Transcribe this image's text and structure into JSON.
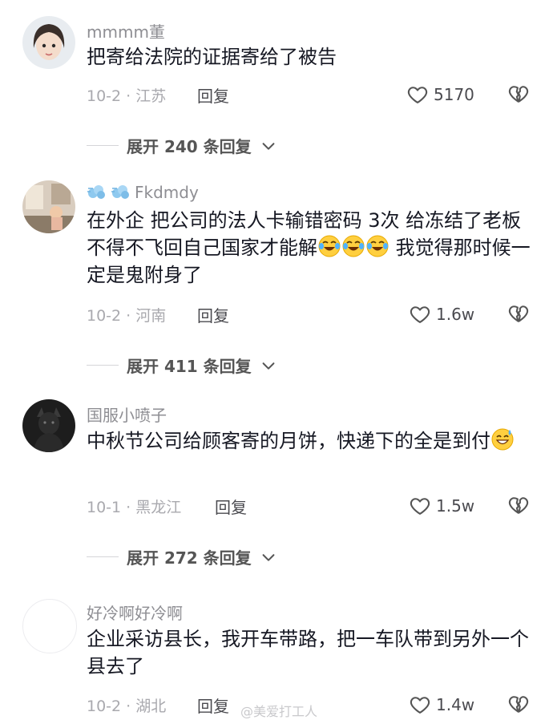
{
  "comments": [
    {
      "username": "mmmm董",
      "text": "把寄给法院的证据寄给了被告",
      "date": "10-2 · 江苏",
      "reply": "回复",
      "likes": "5170",
      "expand": "展开 240 条回复"
    },
    {
      "username": "Fkdmdy",
      "text_a": "在外企 把公司的法人卡输错密码 3次 给冻结了老板不得不飞回自己国家才能解",
      "text_b": " 我觉得那时候一定是鬼附身了",
      "date": "10-2 · 河南",
      "reply": "回复",
      "likes": "1.6w",
      "expand": "展开 411 条回复"
    },
    {
      "username": "国服小喷子",
      "text": "中秋节公司给顾客寄的月饼，快递下的全是到付",
      "date": "10-1 · 黑龙江",
      "reply": "回复",
      "likes": "1.5w",
      "expand": "展开 272 条回复"
    },
    {
      "username": "好冷啊好冷啊",
      "text": "企业采访县长，我开车带路，把一车队带到另外一个县去了",
      "date": "10-2 · 湖北",
      "reply": "回复",
      "likes": "1.4w"
    }
  ],
  "watermark": "@美爱打工人",
  "icons": {
    "like": "heart-outline-icon",
    "dislike": "broken-heart-icon",
    "expand": "chevron-down-icon",
    "emoji_cry": "crying-laugh-emoji",
    "emoji_sweat": "sweat-smile-emoji",
    "badge": "wind-puff-icon"
  }
}
